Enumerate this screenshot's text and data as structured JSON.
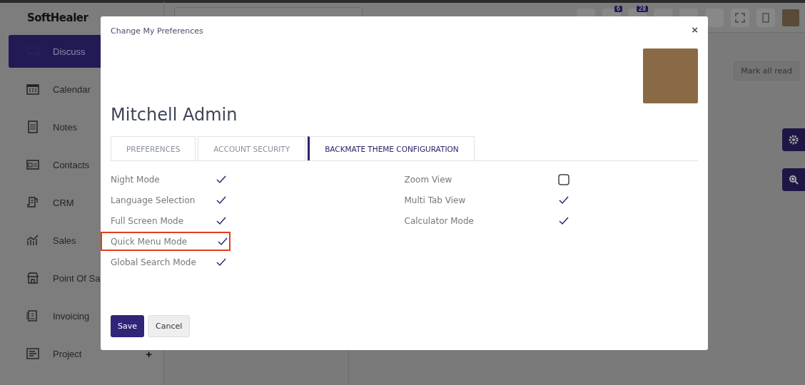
{
  "app": {
    "logo": "SoftHealer",
    "sidebar": {
      "items": [
        {
          "label": "Discuss",
          "selected": true
        },
        {
          "label": "Calendar",
          "selected": false
        },
        {
          "label": "Notes",
          "selected": false
        },
        {
          "label": "Contacts",
          "selected": false
        },
        {
          "label": "CRM",
          "selected": false
        },
        {
          "label": "Sales",
          "selected": false
        },
        {
          "label": "Point Of Sa",
          "selected": false
        },
        {
          "label": "Invoicing",
          "selected": false
        },
        {
          "label": "Project",
          "selected": false,
          "action": "+"
        }
      ]
    },
    "topbar": {
      "badges": [
        "6",
        "28"
      ]
    },
    "mark_all_read": "Mark all read"
  },
  "dialog": {
    "title": "Change My Preferences",
    "close": "×",
    "user_name": "Mitchell Admin",
    "tabs": [
      {
        "label": "PREFERENCES",
        "selected": false
      },
      {
        "label": "ACCOUNT SECURITY",
        "selected": false
      },
      {
        "label": "BACKMATE THEME CONFIGURATION",
        "selected": true
      }
    ],
    "left_options": [
      {
        "label": "Night Mode",
        "checked": true,
        "highlighted": false
      },
      {
        "label": "Language Selection",
        "checked": true,
        "highlighted": false
      },
      {
        "label": "Full Screen Mode",
        "checked": true,
        "highlighted": false
      },
      {
        "label": "Quick Menu Mode",
        "checked": true,
        "highlighted": true
      },
      {
        "label": "Global Search Mode",
        "checked": true,
        "highlighted": false
      }
    ],
    "right_options": [
      {
        "label": "Zoom View",
        "checked": false,
        "highlighted": false
      },
      {
        "label": "Multi Tab View",
        "checked": true,
        "highlighted": false
      },
      {
        "label": "Calculator Mode",
        "checked": true,
        "highlighted": false
      }
    ],
    "buttons": [
      {
        "label": "Save",
        "kind": "primary"
      },
      {
        "label": "Cancel",
        "kind": "secondary"
      }
    ]
  }
}
